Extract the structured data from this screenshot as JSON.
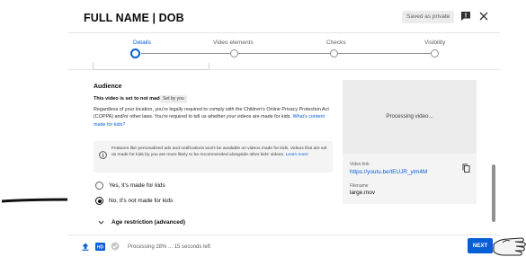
{
  "header": {
    "title": "FULL NAME | DOB",
    "saved_badge": "Saved as private",
    "icons": [
      "feedback-icon",
      "close-icon"
    ]
  },
  "stepper": {
    "steps": [
      {
        "label": "Details",
        "active": true
      },
      {
        "label": "Video elements",
        "active": false
      },
      {
        "label": "Checks",
        "active": false
      },
      {
        "label": "Visibility",
        "active": false
      }
    ]
  },
  "audience": {
    "title": "Audience",
    "status": "This video is set to not made for kids",
    "status_badge": "Set by you",
    "description": "Regardless of your location, you're legally required to comply with the Children's Online Privacy Protection Act (COPPA) and/or other laws. You're required to tell us whether your videos are made for kids.",
    "description_link": "What's content made for kids?",
    "info_text": "Features like personalized ads and notifications won't be available on videos made for kids. Videos that are set as made for kids by you are more likely to be recommended alongside other kids' videos.",
    "info_link": "Learn more",
    "options": [
      {
        "label": "Yes, it's made for kids",
        "checked": false
      },
      {
        "label": "No, it's not made for kids",
        "checked": true
      }
    ],
    "age_restriction": "Age restriction (advanced)"
  },
  "preview": {
    "processing": "Processing video...",
    "video_link_label": "Video link",
    "video_link": "https://youtu.be/tEUJR_ylm4M",
    "filename_label": "Filename",
    "filename": "large.mov"
  },
  "footer": {
    "processing_text": "Processing 28% ... 15 seconds left",
    "next_label": "NEXT"
  },
  "colors": {
    "accent": "#065fd4",
    "text": "#0d0d0d",
    "muted": "#606060",
    "panel": "#f4f4f4"
  }
}
